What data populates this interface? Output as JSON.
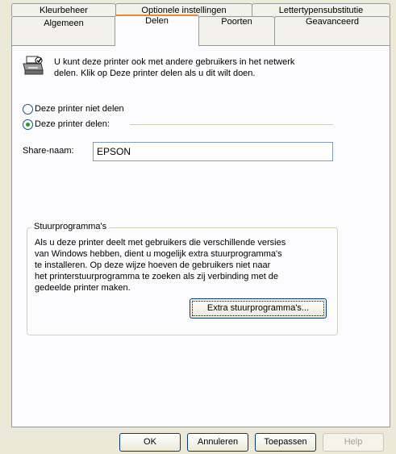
{
  "tabs_row1": [
    {
      "label": "Kleurbeheer"
    },
    {
      "label": "Optionele instellingen"
    },
    {
      "label": "Lettertypensubstitutie"
    }
  ],
  "tabs_row2": [
    {
      "label": "Algemeen"
    },
    {
      "label": "Delen",
      "active": true
    },
    {
      "label": "Poorten"
    },
    {
      "label": "Geavanceerd"
    }
  ],
  "info": {
    "line1": "U kunt deze printer ook met andere gebruikers in het netwerk",
    "line2": "delen. Klik op Deze printer delen als u dit wilt doen."
  },
  "options": {
    "not_share": "Deze printer niet delen",
    "share": "Deze printer delen:",
    "selected": "share"
  },
  "share_name": {
    "label": "Share-naam:",
    "value": "EPSON"
  },
  "drivers": {
    "legend": "Stuurprogramma's",
    "line1": "Als u deze printer deelt met gebruikers die verschillende versies",
    "line2": "van Windows hebben, dient u mogelijk extra stuurprogramma's",
    "line3": "te installeren. Op deze wijze hoeven de gebruikers niet naar",
    "line4": "het printerstuurprogramma te zoeken als zij verbinding met de",
    "line5": "gedeelde printer maken.",
    "button": "Extra stuurprogramma's..."
  },
  "buttons": {
    "ok": "OK",
    "cancel": "Annuleren",
    "apply": "Toepassen",
    "help": "Help"
  }
}
